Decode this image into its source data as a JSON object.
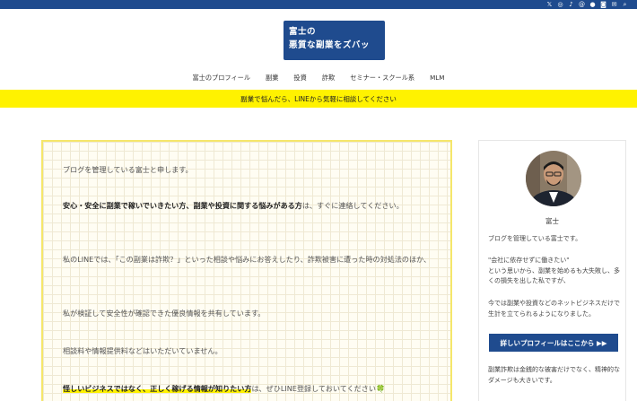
{
  "topbar": {
    "icons": [
      {
        "name": "x-icon",
        "glyph": "𝕏"
      },
      {
        "name": "instagram-icon",
        "glyph": "◎"
      },
      {
        "name": "tiktok-icon",
        "glyph": "♪"
      },
      {
        "name": "threads-icon",
        "glyph": "@"
      },
      {
        "name": "line-icon",
        "glyph": "●"
      },
      {
        "name": "rss-icon",
        "glyph": "◙"
      },
      {
        "name": "mail-icon",
        "glyph": "✉"
      },
      {
        "name": "search-icon",
        "glyph": "⌕"
      }
    ]
  },
  "site": {
    "logo_line1": "富士の",
    "logo_line2": "悪質な副業をズバッ"
  },
  "nav": {
    "items": [
      "富士のプロフィール",
      "副業",
      "投資",
      "詐欺",
      "セミナー・スクール系",
      "MLM"
    ]
  },
  "banner": {
    "text": "副業で悩んだら、LINEから気軽に相談してください"
  },
  "main": {
    "p1": "ブログを管理している富士と申します。",
    "p2_bold": "安心・安全に副業で稼いでいきたい方、副業や投資に関する悩みがある方",
    "p2_rest": "は、すぐに連絡してください。",
    "p3": "私のLINEでは、「この副業は詐欺？」といった相談や悩みにお答えしたり、詐欺被害に遭った時の対処法のほか、",
    "p4": "私が検証して安全性が確認できた優良情報を共有しています。",
    "p5": "相談料や情報提供料などはいただいていません。",
    "p6_marker": "怪しいビジネスではなく、正しく稼げる情報が知りたい方",
    "p6_rest": "は、ぜひLINE登録しておいてください",
    "p6_emoji": "🍀"
  },
  "sidebar": {
    "name": "富士",
    "intro": "ブログを管理している富士です。",
    "quote_l1": "\"会社に依存せずに働きたい\"",
    "quote_l2": "という思いから、副業を始めるも大失敗し、多くの損失を出した私ですが、",
    "now": "今では副業や投資などのネットビジネスだけで生計を立てられるようになりました。",
    "button_label": "詳しいプロフィールはここから ▶▶",
    "scam": "副業詐欺は金銭的な被害だけでなく、精神的なダメージも大きいです。"
  },
  "colors": {
    "brand_blue": "#1f4b8e",
    "banner_yellow": "#fff200",
    "box_border": "#f5e66a"
  }
}
